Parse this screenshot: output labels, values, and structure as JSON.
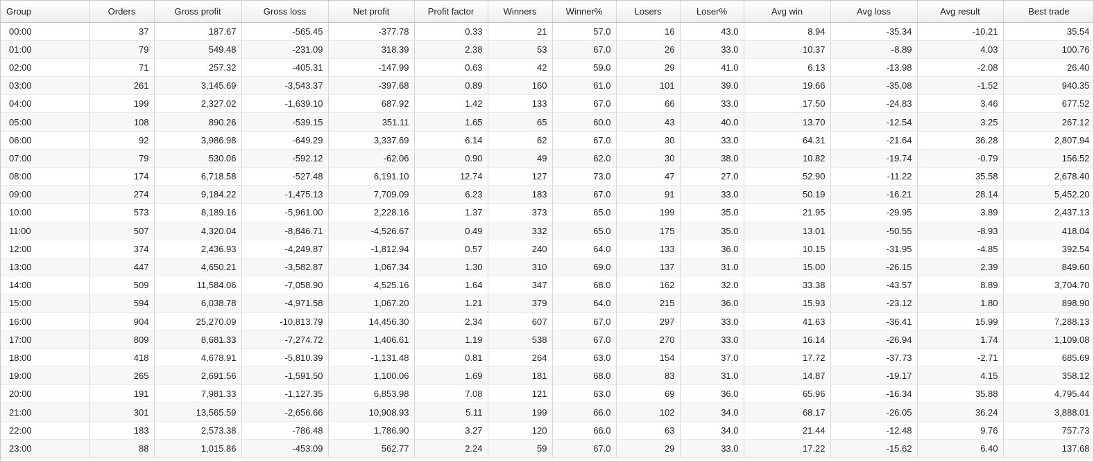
{
  "columns": [
    {
      "key": "group",
      "label": "Group"
    },
    {
      "key": "orders",
      "label": "Orders"
    },
    {
      "key": "gross_profit",
      "label": "Gross profit"
    },
    {
      "key": "gross_loss",
      "label": "Gross loss"
    },
    {
      "key": "net_profit",
      "label": "Net profit"
    },
    {
      "key": "profit_factor",
      "label": "Profit factor"
    },
    {
      "key": "winners",
      "label": "Winners"
    },
    {
      "key": "winner_pct",
      "label": "Winner%"
    },
    {
      "key": "losers",
      "label": "Losers"
    },
    {
      "key": "loser_pct",
      "label": "Loser%"
    },
    {
      "key": "avg_win",
      "label": "Avg win"
    },
    {
      "key": "avg_loss",
      "label": "Avg loss"
    },
    {
      "key": "avg_result",
      "label": "Avg result"
    },
    {
      "key": "best_trade",
      "label": "Best trade"
    }
  ],
  "rows": [
    [
      "00:00",
      "37",
      "187.67",
      "-565.45",
      "-377.78",
      "0.33",
      "21",
      "57.0",
      "16",
      "43.0",
      "8.94",
      "-35.34",
      "-10.21",
      "35.54"
    ],
    [
      "01:00",
      "79",
      "549.48",
      "-231.09",
      "318.39",
      "2.38",
      "53",
      "67.0",
      "26",
      "33.0",
      "10.37",
      "-8.89",
      "4.03",
      "100.76"
    ],
    [
      "02:00",
      "71",
      "257.32",
      "-405.31",
      "-147.99",
      "0.63",
      "42",
      "59.0",
      "29",
      "41.0",
      "6.13",
      "-13.98",
      "-2.08",
      "26.40"
    ],
    [
      "03:00",
      "261",
      "3,145.69",
      "-3,543.37",
      "-397.68",
      "0.89",
      "160",
      "61.0",
      "101",
      "39.0",
      "19.66",
      "-35.08",
      "-1.52",
      "940.35"
    ],
    [
      "04:00",
      "199",
      "2,327.02",
      "-1,639.10",
      "687.92",
      "1.42",
      "133",
      "67.0",
      "66",
      "33.0",
      "17.50",
      "-24.83",
      "3.46",
      "677.52"
    ],
    [
      "05:00",
      "108",
      "890.26",
      "-539.15",
      "351.11",
      "1.65",
      "65",
      "60.0",
      "43",
      "40.0",
      "13.70",
      "-12.54",
      "3.25",
      "267.12"
    ],
    [
      "06:00",
      "92",
      "3,986.98",
      "-649.29",
      "3,337.69",
      "6.14",
      "62",
      "67.0",
      "30",
      "33.0",
      "64.31",
      "-21.64",
      "36.28",
      "2,807.94"
    ],
    [
      "07:00",
      "79",
      "530.06",
      "-592.12",
      "-62.06",
      "0.90",
      "49",
      "62.0",
      "30",
      "38.0",
      "10.82",
      "-19.74",
      "-0.79",
      "156.52"
    ],
    [
      "08:00",
      "174",
      "6,718.58",
      "-527.48",
      "6,191.10",
      "12.74",
      "127",
      "73.0",
      "47",
      "27.0",
      "52.90",
      "-11.22",
      "35.58",
      "2,678.40"
    ],
    [
      "09:00",
      "274",
      "9,184.22",
      "-1,475.13",
      "7,709.09",
      "6.23",
      "183",
      "67.0",
      "91",
      "33.0",
      "50.19",
      "-16.21",
      "28.14",
      "5,452.20"
    ],
    [
      "10:00",
      "573",
      "8,189.16",
      "-5,961.00",
      "2,228.16",
      "1.37",
      "373",
      "65.0",
      "199",
      "35.0",
      "21.95",
      "-29.95",
      "3.89",
      "2,437.13"
    ],
    [
      "11:00",
      "507",
      "4,320.04",
      "-8,846.71",
      "-4,526.67",
      "0.49",
      "332",
      "65.0",
      "175",
      "35.0",
      "13.01",
      "-50.55",
      "-8.93",
      "418.04"
    ],
    [
      "12:00",
      "374",
      "2,436.93",
      "-4,249.87",
      "-1,812.94",
      "0.57",
      "240",
      "64.0",
      "133",
      "36.0",
      "10.15",
      "-31.95",
      "-4.85",
      "392.54"
    ],
    [
      "13:00",
      "447",
      "4,650.21",
      "-3,582.87",
      "1,067.34",
      "1.30",
      "310",
      "69.0",
      "137",
      "31.0",
      "15.00",
      "-26.15",
      "2.39",
      "849.60"
    ],
    [
      "14:00",
      "509",
      "11,584.06",
      "-7,058.90",
      "4,525.16",
      "1.64",
      "347",
      "68.0",
      "162",
      "32.0",
      "33.38",
      "-43.57",
      "8.89",
      "3,704.70"
    ],
    [
      "15:00",
      "594",
      "6,038.78",
      "-4,971.58",
      "1,067.20",
      "1.21",
      "379",
      "64.0",
      "215",
      "36.0",
      "15.93",
      "-23.12",
      "1.80",
      "898.90"
    ],
    [
      "16:00",
      "904",
      "25,270.09",
      "-10,813.79",
      "14,456.30",
      "2.34",
      "607",
      "67.0",
      "297",
      "33.0",
      "41.63",
      "-36.41",
      "15.99",
      "7,288.13"
    ],
    [
      "17:00",
      "809",
      "8,681.33",
      "-7,274.72",
      "1,406.61",
      "1.19",
      "538",
      "67.0",
      "270",
      "33.0",
      "16.14",
      "-26.94",
      "1.74",
      "1,109.08"
    ],
    [
      "18:00",
      "418",
      "4,678.91",
      "-5,810.39",
      "-1,131.48",
      "0.81",
      "264",
      "63.0",
      "154",
      "37.0",
      "17.72",
      "-37.73",
      "-2.71",
      "685.69"
    ],
    [
      "19:00",
      "265",
      "2,691.56",
      "-1,591.50",
      "1,100.06",
      "1.69",
      "181",
      "68.0",
      "83",
      "31.0",
      "14.87",
      "-19.17",
      "4.15",
      "358.12"
    ],
    [
      "20:00",
      "191",
      "7,981.33",
      "-1,127.35",
      "6,853.98",
      "7.08",
      "121",
      "63.0",
      "69",
      "36.0",
      "65.96",
      "-16.34",
      "35.88",
      "4,795.44"
    ],
    [
      "21:00",
      "301",
      "13,565.59",
      "-2,656.66",
      "10,908.93",
      "5.11",
      "199",
      "66.0",
      "102",
      "34.0",
      "68.17",
      "-26.05",
      "36.24",
      "3,888.01"
    ],
    [
      "22:00",
      "183",
      "2,573.38",
      "-786.48",
      "1,786.90",
      "3.27",
      "120",
      "66.0",
      "63",
      "34.0",
      "21.44",
      "-12.48",
      "9.76",
      "757.73"
    ],
    [
      "23:00",
      "88",
      "1,015.86",
      "-453.09",
      "562.77",
      "2.24",
      "59",
      "67.0",
      "29",
      "33.0",
      "17.22",
      "-15.62",
      "6.40",
      "137.68"
    ]
  ]
}
